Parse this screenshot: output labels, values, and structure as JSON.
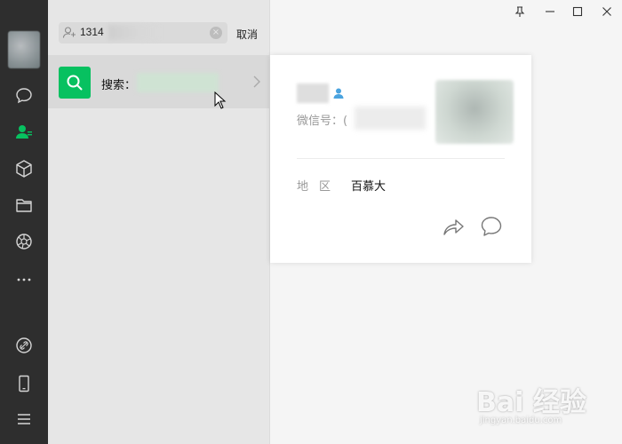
{
  "search": {
    "query": "1314",
    "clear_symbol": "×",
    "cancel_label": "取消"
  },
  "result": {
    "label": "搜索："
  },
  "profile": {
    "wechat_id_label": "微信号：(",
    "region_label": "地区",
    "region_value": "百慕大"
  },
  "watermark": {
    "main": "Bai 经验",
    "sub": "jingyan.baidu.com"
  },
  "icons": {
    "sidebar": [
      "chat-icon",
      "contacts-icon",
      "box-icon",
      "folder-icon",
      "aperture-icon",
      "more-icon",
      "link-icon",
      "phone-icon",
      "menu-icon"
    ],
    "window": [
      "pin-icon",
      "minimize-icon",
      "maximize-icon",
      "close-icon"
    ]
  },
  "colors": {
    "accent": "#07c160",
    "sidebar": "#2e2e2e",
    "contact_blue": "#4aa3df"
  }
}
